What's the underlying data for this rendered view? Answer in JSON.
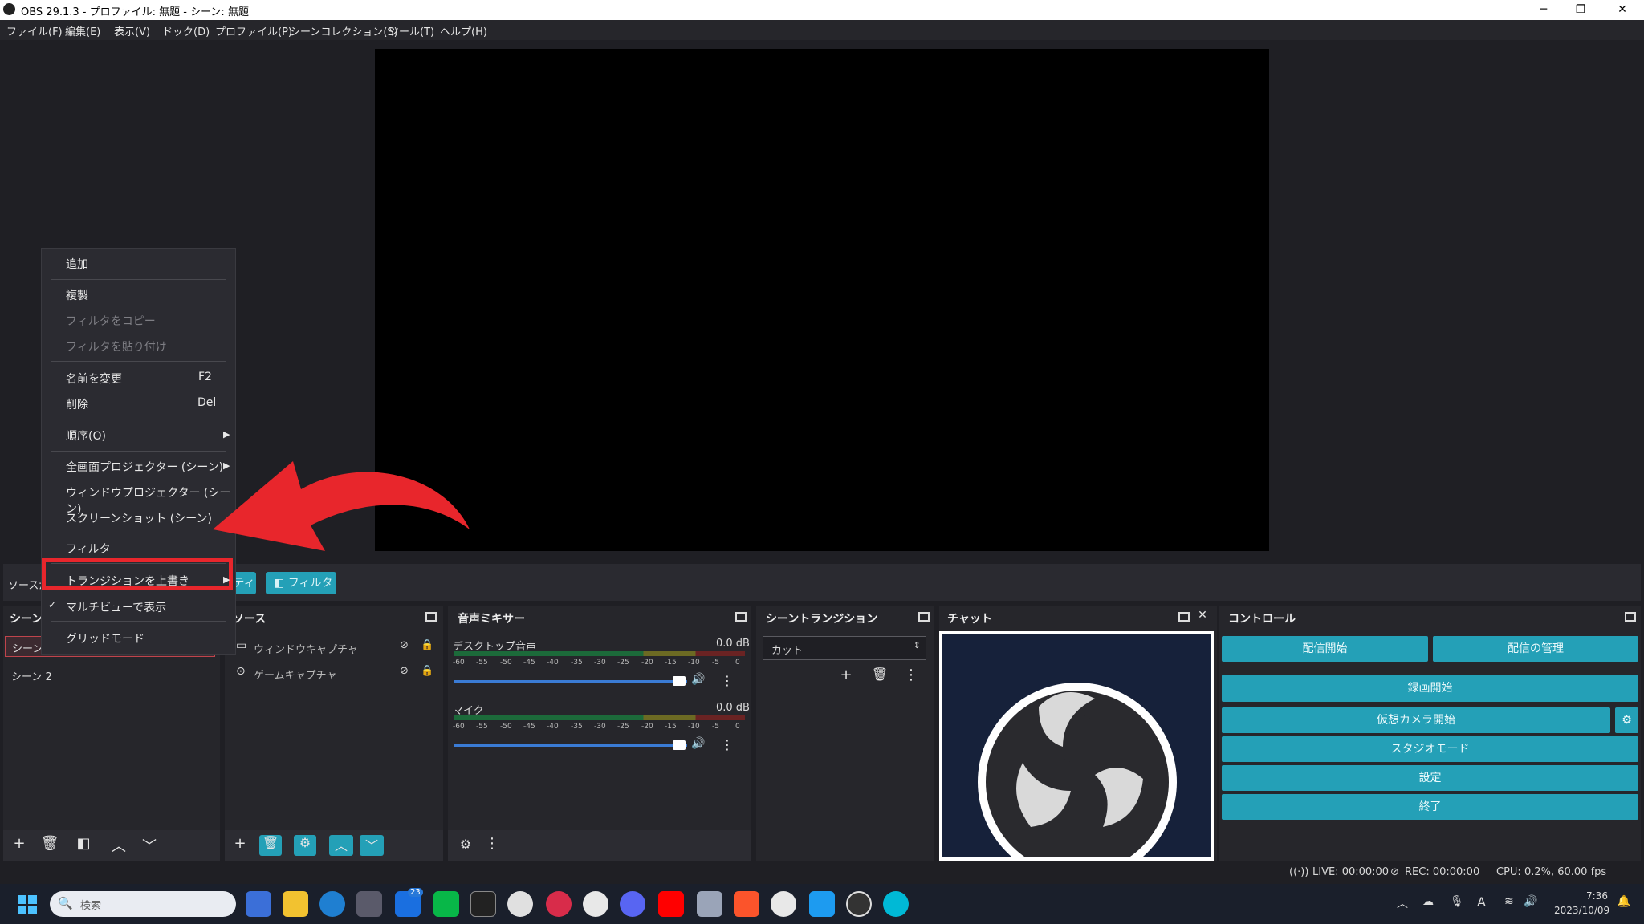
{
  "window": {
    "title": "OBS 29.1.3 - プロファイル: 無題 - シーン: 無題"
  },
  "menu": [
    "ファイル(F)",
    "編集(E)",
    "表示(V)",
    "ドック(D)",
    "プロファイル(P)",
    "シーンコレクション(S)",
    "ツール(T)",
    "ヘルプ(H)"
  ],
  "source_strip": {
    "label": "ソースが",
    "partial_btn": "ティ",
    "filter_btn": "フィルタ"
  },
  "context_menu": {
    "add": "追加",
    "duplicate": "複製",
    "copy_filters": "フィルタをコピー",
    "paste_filters": "フィルタを貼り付け",
    "rename": "名前を変更",
    "rename_key": "F2",
    "remove": "削除",
    "remove_key": "Del",
    "order": "順序(O)",
    "fullscreen_projector": "全画面プロジェクター (シーン)",
    "window_projector": "ウィンドウプロジェクター (シーン)",
    "screenshot": "スクリーンショット (シーン)",
    "filters": "フィルタ",
    "transition_override": "トランジションを上書き",
    "multiview": "マルチビューで表示",
    "grid_mode": "グリッドモード"
  },
  "scenes": {
    "title": "シーン",
    "items": [
      "シーン",
      "シーン 2"
    ]
  },
  "sources": {
    "title": "ソース",
    "items": [
      "ウィンドウキャプチャ",
      "ゲームキャプチャ"
    ]
  },
  "mixer": {
    "title": "音声ミキサー",
    "channels": [
      {
        "name": "デスクトップ音声",
        "db": "0.0 dB",
        "volume": 1.0
      },
      {
        "name": "マイク",
        "db": "0.0 dB",
        "volume": 1.0
      }
    ],
    "ticks": [
      "-60",
      "-55",
      "-50",
      "-45",
      "-40",
      "-35",
      "-30",
      "-25",
      "-20",
      "-15",
      "-10",
      "-5",
      "0"
    ]
  },
  "transitions": {
    "title": "シーントランジション",
    "selected": "カット"
  },
  "chat": {
    "title": "チャット"
  },
  "controls": {
    "title": "コントロール",
    "start_stream": "配信開始",
    "manage_stream": "配信の管理",
    "start_record": "録画開始",
    "start_vcam": "仮想カメラ開始",
    "studio_mode": "スタジオモード",
    "settings": "設定",
    "exit": "終了"
  },
  "status": {
    "live": "LIVE: 00:00:00",
    "rec": "REC: 00:00:00",
    "cpu": "CPU: 0.2%, 60.00 fps"
  },
  "taskbar": {
    "search_placeholder": "検索",
    "time": "7:36",
    "date": "2023/10/09",
    "badge": "23",
    "ime": "A"
  },
  "colors": {
    "accent": "#24a0b7",
    "highlight_box": "#e8262c",
    "panel": "#26262b"
  }
}
